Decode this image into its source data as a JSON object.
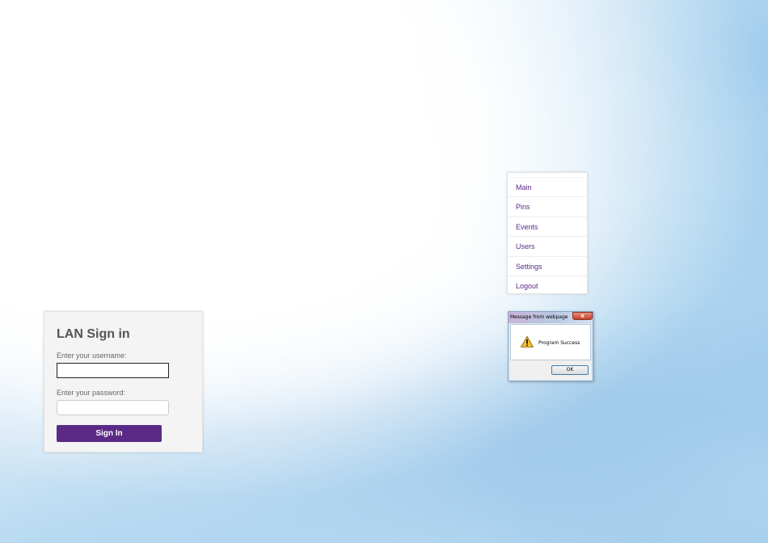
{
  "login": {
    "title": "LAN Sign in",
    "username_label": "Enter your username:",
    "username_value": "",
    "password_label": "Enter your password:",
    "password_value": "",
    "submit_label": "Sign In"
  },
  "menu": {
    "items": [
      {
        "label": "Main"
      },
      {
        "label": "Pins"
      },
      {
        "label": "Events"
      },
      {
        "label": "Users"
      },
      {
        "label": "Settings"
      },
      {
        "label": "Logout"
      }
    ]
  },
  "dialog": {
    "title": "Message from webpage",
    "close_label": "x",
    "message": "Program Success",
    "ok_label": "OK",
    "icon": "warning-icon"
  },
  "colors": {
    "accent": "#5b2a86",
    "background_blue": "#9ccbeb"
  }
}
